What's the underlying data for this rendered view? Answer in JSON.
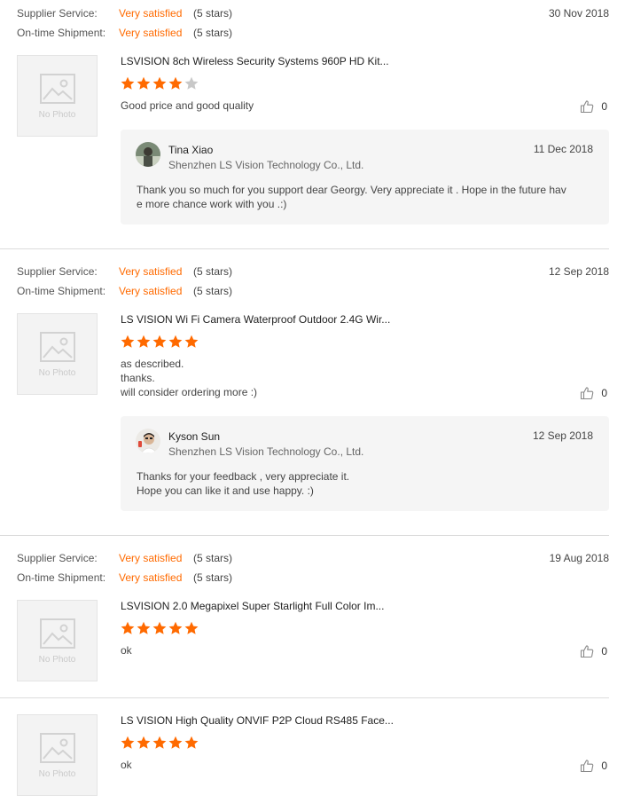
{
  "colors": {
    "accent": "#ff6a00",
    "star_on": "#ff6a00",
    "star_off": "#c8c8c8"
  },
  "meta_labels": {
    "supplier": "Supplier Service:",
    "shipment": "On-time Shipment:"
  },
  "no_photo": "No Photo",
  "reviews": [
    {
      "supplier_rating": "Very satisfied",
      "supplier_stars": "(5 stars)",
      "shipment_rating": "Very satisfied",
      "shipment_stars": "(5 stars)",
      "date": "30 Nov 2018",
      "product": "LSVISION 8ch Wireless Security Systems 960P HD Kit...",
      "rating": 4,
      "text": "Good price and good quality",
      "likes": "0",
      "reply": {
        "name": "Tina Xiao",
        "company": "Shenzhen LS Vision Technology Co., Ltd.",
        "date": "11 Dec 2018",
        "text": "Thank you so much for you support dear Georgy. Very appreciate it . Hope in the future hav\ne more chance work with you .:)"
      }
    },
    {
      "supplier_rating": "Very satisfied",
      "supplier_stars": "(5 stars)",
      "shipment_rating": "Very satisfied",
      "shipment_stars": "(5 stars)",
      "date": "12 Sep 2018",
      "product": "LS VISION Wi Fi Camera Waterproof Outdoor 2.4G Wir...",
      "rating": 5,
      "text": "as described.\nthanks.\nwill consider ordering more :)",
      "likes": "0",
      "reply": {
        "name": "Kyson Sun",
        "company": "Shenzhen LS Vision Technology Co., Ltd.",
        "date": "12 Sep 2018",
        "text": "Thanks for your feedback , very appreciate it.\n Hope you can like it and use happy. :)"
      }
    },
    {
      "supplier_rating": "Very satisfied",
      "supplier_stars": "(5 stars)",
      "shipment_rating": "Very satisfied",
      "shipment_stars": "(5 stars)",
      "date": "19 Aug 2018",
      "product": "LSVISION 2.0 Megapixel Super Starlight Full Color Im...",
      "rating": 5,
      "text": "ok",
      "likes": "0"
    },
    {
      "product": "LS VISION High Quality ONVIF P2P Cloud RS485 Face...",
      "rating": 5,
      "text": "ok",
      "likes": "0"
    }
  ]
}
